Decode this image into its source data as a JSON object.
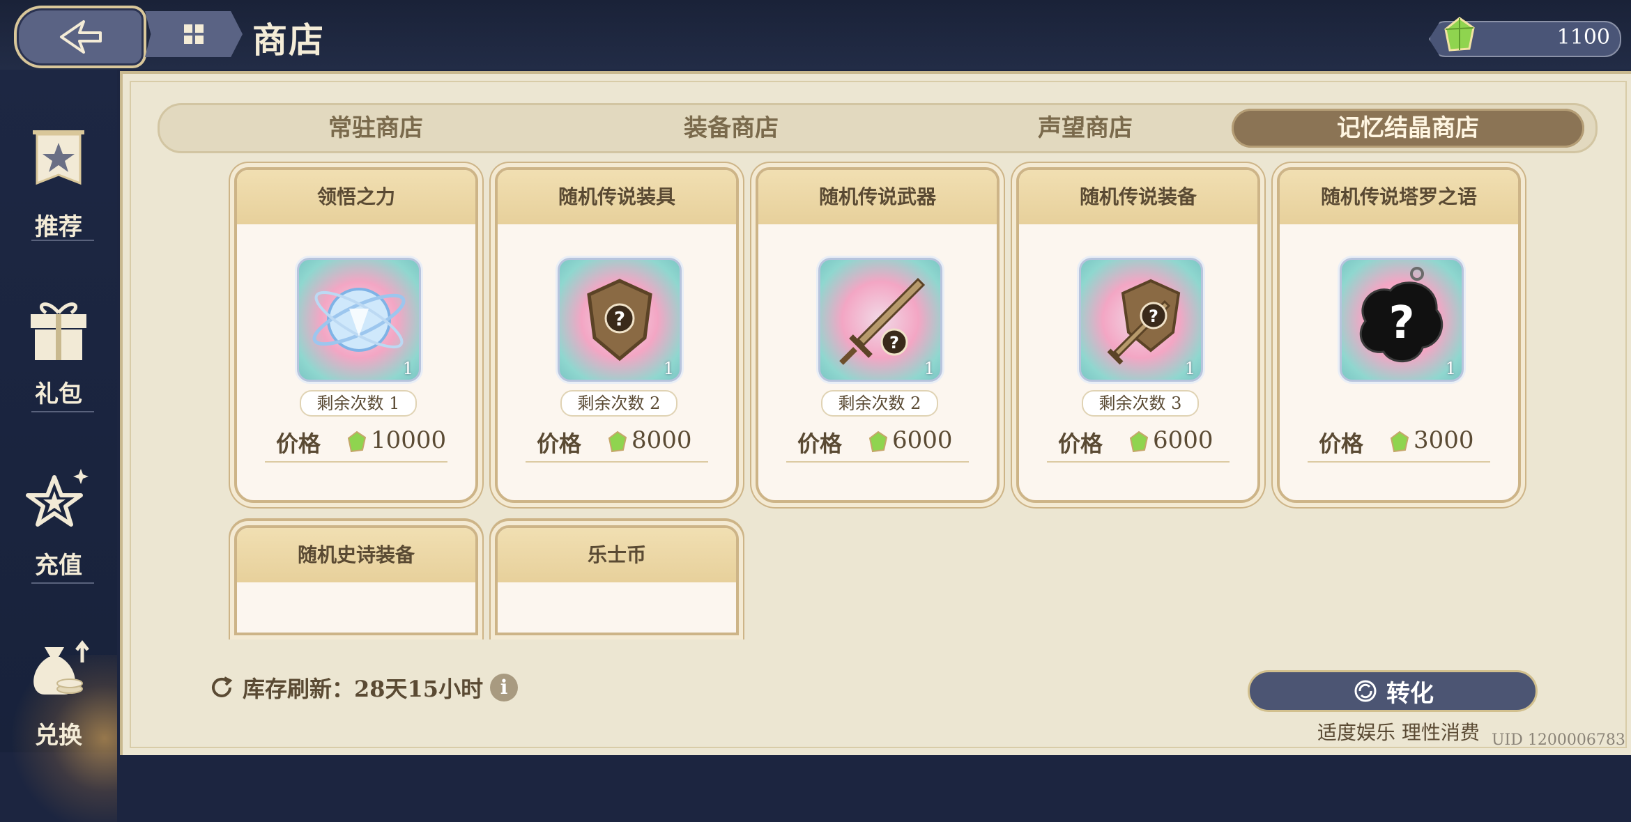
{
  "header": {
    "title": "商店",
    "currency_value": "1100"
  },
  "sidebar": {
    "items": [
      {
        "label": "推荐",
        "icon": "star-banner-icon"
      },
      {
        "label": "礼包",
        "icon": "gift-icon"
      },
      {
        "label": "充值",
        "icon": "sparkle-star-icon"
      },
      {
        "label": "兑换",
        "icon": "money-bag-icon"
      }
    ]
  },
  "tabs": [
    {
      "label": "常驻商店"
    },
    {
      "label": "装备商店"
    },
    {
      "label": "声望商店"
    },
    {
      "label": "记忆结晶商店",
      "active": true
    }
  ],
  "cards": [
    {
      "title": "领悟之力",
      "icon": "crystal-orb-icon",
      "quantity": "1",
      "remain": "剩余次数 1",
      "price_label": "价格",
      "price": "10000"
    },
    {
      "title": "随机传说装具",
      "icon": "shield-question-icon",
      "quantity": "1",
      "remain": "剩余次数 2",
      "price_label": "价格",
      "price": "8000"
    },
    {
      "title": "随机传说武器",
      "icon": "sword-question-icon",
      "quantity": "1",
      "remain": "剩余次数 2",
      "price_label": "价格",
      "price": "6000"
    },
    {
      "title": "随机传说装备",
      "icon": "sword-shield-question-icon",
      "quantity": "1",
      "remain": "剩余次数 3",
      "price_label": "价格",
      "price": "6000"
    },
    {
      "title": "随机传说塔罗之语",
      "icon": "tarot-question-icon",
      "quantity": "1",
      "remain": "",
      "price_label": "价格",
      "price": "3000"
    },
    {
      "title": "随机史诗装备"
    },
    {
      "title": "乐士币"
    }
  ],
  "footer": {
    "refresh_text": "库存刷新：28天15小时",
    "convert_label": "转化",
    "note": "适度娱乐 理性消费",
    "uid": "UID 1200006783"
  },
  "colors": {
    "accent_dark": "#4c5573",
    "tab_active": "#8b7455",
    "panel": "#ece6d2"
  }
}
